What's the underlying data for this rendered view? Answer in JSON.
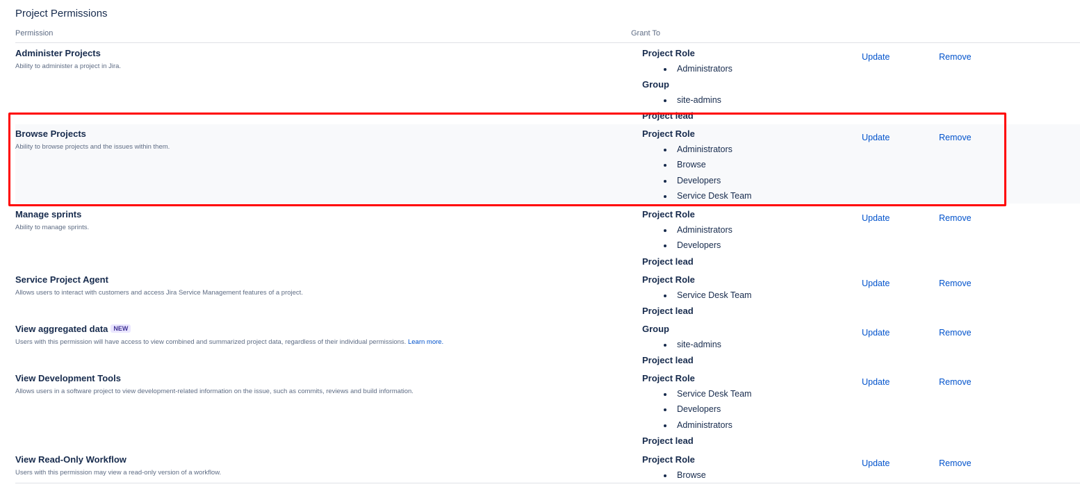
{
  "page": {
    "title": "Project Permissions",
    "columns": {
      "permission": "Permission",
      "grant_to": "Grant To"
    },
    "actions": {
      "update": "Update",
      "remove": "Remove"
    }
  },
  "permissions": [
    {
      "name": "Administer Projects",
      "description": "Ability to administer a project in Jira.",
      "grants": [
        {
          "type": "Project Role",
          "items": [
            "Administrators"
          ]
        },
        {
          "type": "Group",
          "items": [
            "site-admins"
          ]
        },
        {
          "type": "Project lead",
          "items": []
        }
      ]
    },
    {
      "name": "Browse Projects",
      "description": "Ability to browse projects and the issues within them.",
      "highlighted": true,
      "grants": [
        {
          "type": "Project Role",
          "items": [
            "Administrators",
            "Browse",
            "Developers",
            "Service Desk Team"
          ]
        }
      ]
    },
    {
      "name": "Manage sprints",
      "description": "Ability to manage sprints.",
      "grants": [
        {
          "type": "Project Role",
          "items": [
            "Administrators",
            "Developers"
          ]
        },
        {
          "type": "Project lead",
          "items": []
        }
      ]
    },
    {
      "name": "Service Project Agent",
      "description": "Allows users to interact with customers and access Jira Service Management features of a project.",
      "grants": [
        {
          "type": "Project Role",
          "items": [
            "Service Desk Team"
          ]
        },
        {
          "type": "Project lead",
          "items": []
        }
      ]
    },
    {
      "name": "View aggregated data",
      "badge": "NEW",
      "description": "Users with this permission will have access to view combined and summarized project data, regardless of their individual permissions.",
      "link": "Learn more.",
      "grants": [
        {
          "type": "Group",
          "items": [
            "site-admins"
          ]
        },
        {
          "type": "Project lead",
          "items": []
        }
      ]
    },
    {
      "name": "View Development Tools",
      "description": "Allows users in a software project to view development-related information on the issue, such as commits, reviews and build information.",
      "grants": [
        {
          "type": "Project Role",
          "items": [
            "Service Desk Team",
            "Developers",
            "Administrators"
          ]
        },
        {
          "type": "Project lead",
          "items": []
        }
      ]
    },
    {
      "name": "View Read-Only Workflow",
      "description": "Users with this permission may view a read-only version of a workflow.",
      "grants": [
        {
          "type": "Project Role",
          "items": [
            "Browse"
          ]
        }
      ]
    }
  ],
  "colors": {
    "link": "#0052cc",
    "text": "#172b4d",
    "muted": "#5e6c84",
    "highlight_border": "#ff0000",
    "badge_bg": "#eae6ff",
    "badge_text": "#403294"
  }
}
